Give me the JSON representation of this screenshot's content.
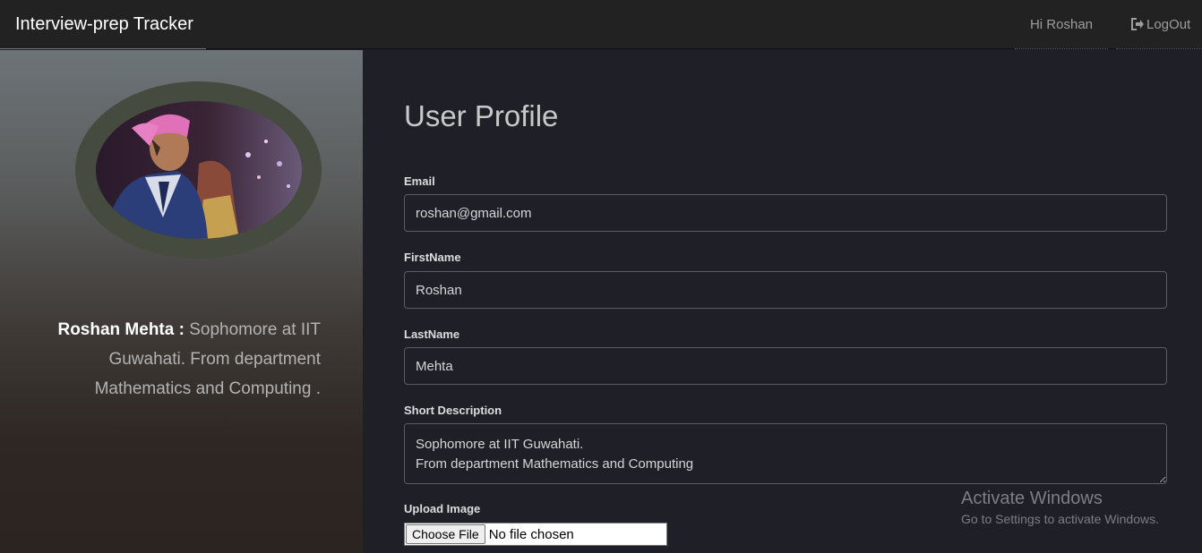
{
  "navbar": {
    "brand": "Interview-prep Tracker",
    "greeting": "Hi Roshan",
    "logout_label": "LogOut"
  },
  "sidebar": {
    "name": "Roshan Mehta :",
    "bio": "Sophomore at IIT Guwahati. From department Mathematics and Computing ."
  },
  "profile": {
    "title": "User Profile",
    "email_label": "Email",
    "email_value": "roshan@gmail.com",
    "first_name_label": "FirstName",
    "first_name_value": "Roshan",
    "last_name_label": "LastName",
    "last_name_value": "Mehta",
    "description_label": "Short Description",
    "description_value": "Sophomore at IIT Guwahati.\nFrom department Mathematics and Computing",
    "upload_label": "Upload Image",
    "file_button": "Choose File",
    "file_status": "No file chosen"
  },
  "watermark": {
    "title": "Activate Windows",
    "subtitle": "Go to Settings to activate Windows."
  },
  "icons": {
    "logout": "logout-icon",
    "avatar": "profile-photo"
  }
}
